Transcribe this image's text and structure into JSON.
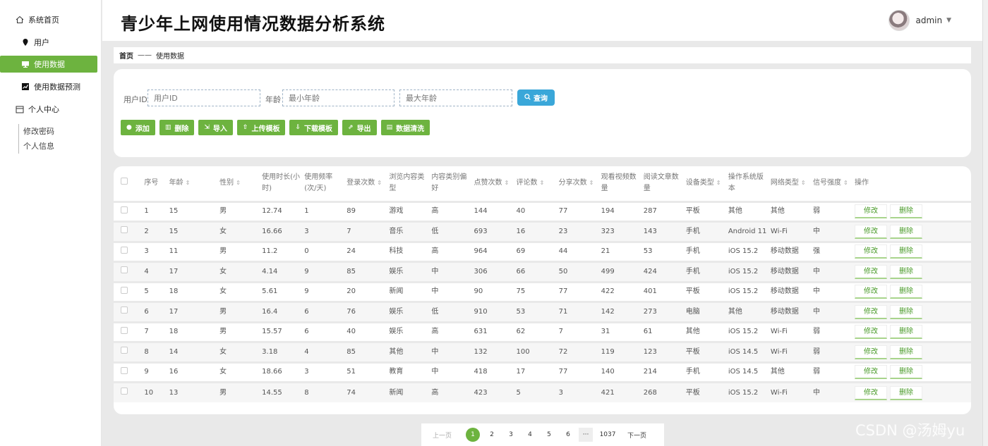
{
  "sidebar": {
    "items": [
      {
        "label": "系统首页"
      },
      {
        "label": "用户"
      },
      {
        "label": "使用数据"
      },
      {
        "label": "使用数据预测"
      },
      {
        "label": "个人中心"
      }
    ],
    "sub": [
      "修改密码",
      "个人信息"
    ]
  },
  "header": {
    "title": "青少年上网使用情况数据分析系统",
    "user": "admin"
  },
  "breadcrumb": {
    "home": "首页",
    "current": "使用数据"
  },
  "search": {
    "uid_label": "用户ID",
    "uid_placeholder": "用户ID",
    "age_label": "年龄",
    "age_min_placeholder": "最小年龄",
    "age_max_placeholder": "最大年龄",
    "query": "查询"
  },
  "actions": [
    "添加",
    "删除",
    "导入",
    "上传模板",
    "下载模板",
    "导出",
    "数据清洗"
  ],
  "table": {
    "headers": [
      "序号",
      "年龄",
      "性别",
      "使用时长(小时)",
      "使用频率(次/天)",
      "登录次数",
      "浏览内容类型",
      "内容类别偏好",
      "点赞次数",
      "评论数",
      "分享次数",
      "观看视频数量",
      "阅读文章数量",
      "设备类型",
      "操作系统版本",
      "网络类型",
      "信号强度",
      "操作"
    ],
    "edit": "修改",
    "delete": "删除",
    "rows": [
      [
        "1",
        "15",
        "男",
        "12.74",
        "1",
        "89",
        "游戏",
        "高",
        "144",
        "40",
        "77",
        "194",
        "287",
        "平板",
        "其他",
        "其他",
        "弱"
      ],
      [
        "2",
        "15",
        "女",
        "16.66",
        "3",
        "7",
        "音乐",
        "低",
        "693",
        "16",
        "23",
        "323",
        "143",
        "手机",
        "Android 11",
        "Wi-Fi",
        "中"
      ],
      [
        "3",
        "11",
        "男",
        "11.2",
        "0",
        "24",
        "科技",
        "高",
        "964",
        "69",
        "44",
        "21",
        "53",
        "手机",
        "iOS 15.2",
        "移动数据",
        "强"
      ],
      [
        "4",
        "17",
        "女",
        "4.14",
        "9",
        "85",
        "娱乐",
        "中",
        "306",
        "66",
        "50",
        "499",
        "424",
        "手机",
        "iOS 15.2",
        "移动数据",
        "中"
      ],
      [
        "5",
        "18",
        "女",
        "5.61",
        "9",
        "20",
        "新闻",
        "中",
        "90",
        "75",
        "77",
        "422",
        "401",
        "平板",
        "iOS 15.2",
        "移动数据",
        "中"
      ],
      [
        "6",
        "17",
        "男",
        "16.4",
        "6",
        "76",
        "娱乐",
        "低",
        "910",
        "53",
        "71",
        "142",
        "273",
        "电脑",
        "其他",
        "移动数据",
        "中"
      ],
      [
        "7",
        "18",
        "男",
        "15.57",
        "6",
        "40",
        "娱乐",
        "高",
        "631",
        "62",
        "7",
        "31",
        "61",
        "其他",
        "iOS 15.2",
        "Wi-Fi",
        "弱"
      ],
      [
        "8",
        "14",
        "女",
        "3.18",
        "4",
        "85",
        "其他",
        "中",
        "132",
        "100",
        "72",
        "119",
        "123",
        "平板",
        "iOS 14.5",
        "Wi-Fi",
        "弱"
      ],
      [
        "9",
        "16",
        "女",
        "18.66",
        "3",
        "51",
        "教育",
        "中",
        "418",
        "17",
        "77",
        "140",
        "214",
        "手机",
        "iOS 14.5",
        "其他",
        "弱"
      ],
      [
        "10",
        "13",
        "男",
        "14.55",
        "8",
        "74",
        "新闻",
        "高",
        "423",
        "5",
        "3",
        "421",
        "268",
        "平板",
        "iOS 15.2",
        "Wi-Fi",
        "中"
      ]
    ]
  },
  "pagination": {
    "prev": "上一页",
    "next": "下一页",
    "current": "1",
    "pages": [
      "2",
      "3",
      "4",
      "5",
      "6"
    ],
    "dots": "···",
    "last": "1037"
  },
  "watermark": "CSDN @汤姆yu",
  "colors": {
    "accent": "#6db33f",
    "query": "#3aa7d9"
  }
}
